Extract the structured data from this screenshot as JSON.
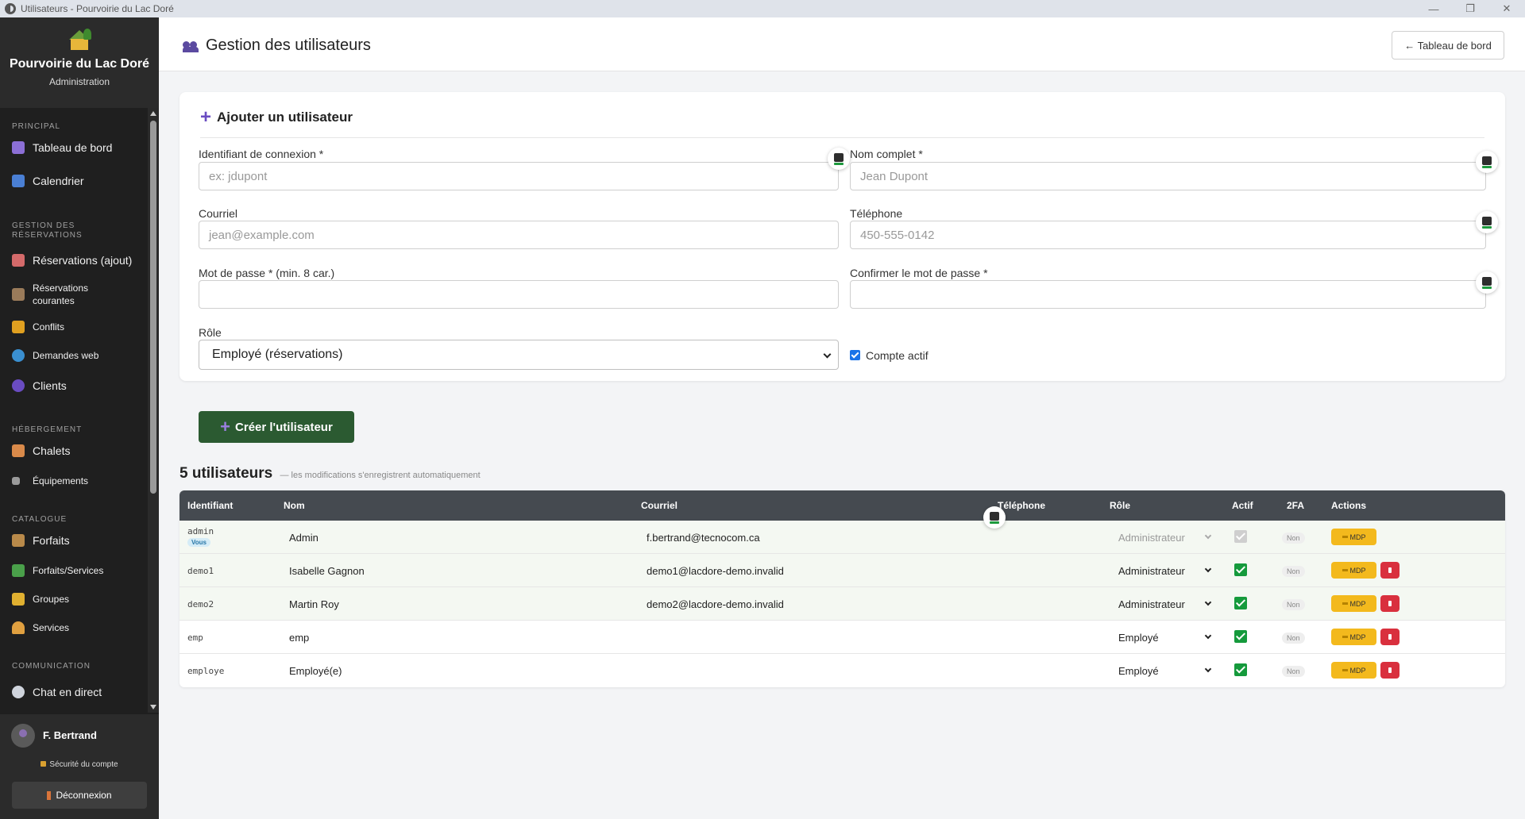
{
  "window": {
    "title": "Utilisateurs - Pourvoirie du Lac Doré",
    "min": "—",
    "restore": "❐",
    "close": "✕"
  },
  "brand": {
    "name": "Pourvoirie du Lac Doré",
    "sub": "Administration",
    "logo_icon": "cabin-logo"
  },
  "sidebar": {
    "sections": [
      {
        "title": "PRINCIPAL",
        "items": [
          {
            "label": "Tableau de bord",
            "icon": "chart-icon",
            "color": "#8c6fd6"
          },
          {
            "label": "Calendrier",
            "icon": "calendar-icon",
            "color": "#4a7fd4"
          }
        ]
      },
      {
        "title": "GESTION DES RÉSERVATIONS",
        "items": [
          {
            "label": "Réservations (ajout)",
            "icon": "memo-icon",
            "color": "#d46a6a"
          },
          {
            "label": "Réservations courantes",
            "icon": "clipboard-icon",
            "color": "#9a7b5a"
          },
          {
            "label": "Conflits",
            "icon": "warning-icon",
            "color": "#e0a020"
          },
          {
            "label": "Demandes web",
            "icon": "globe-icon",
            "color": "#3a8fd0"
          },
          {
            "label": "Clients",
            "icon": "people-icon",
            "color": "#6a4cc1"
          }
        ]
      },
      {
        "title": "HÉBERGEMENT",
        "items": [
          {
            "label": "Chalets",
            "icon": "house-icon",
            "color": "#d98a4a"
          },
          {
            "label": "Équipements",
            "icon": "wrench-icon",
            "color": "#9a9a9a"
          }
        ]
      },
      {
        "title": "CATALOGUE",
        "items": [
          {
            "label": "Forfaits",
            "icon": "package-icon",
            "color": "#b98a4a"
          },
          {
            "label": "Forfaits/Services",
            "icon": "puzzle-icon",
            "color": "#4aa04a"
          },
          {
            "label": "Groupes",
            "icon": "folder-icon",
            "color": "#e0b030"
          },
          {
            "label": "Services",
            "icon": "bell-icon",
            "color": "#e0a040"
          }
        ]
      },
      {
        "title": "COMMUNICATION",
        "items": [
          {
            "label": "Chat en direct",
            "icon": "chat-icon",
            "color": "#cfd4dc"
          }
        ]
      }
    ]
  },
  "user": {
    "name": "F. Bertrand",
    "security": "Sécurité du compte",
    "logout": "Déconnexion"
  },
  "header": {
    "title": "Gestion des utilisateurs",
    "back_label": "← Tableau de bord"
  },
  "form": {
    "title": "Ajouter un utilisateur",
    "login_label": "Identifiant de connexion *",
    "login_placeholder": "ex: jdupont",
    "fullname_label": "Nom complet *",
    "fullname_placeholder": "Jean Dupont",
    "email_label": "Courriel",
    "email_placeholder": "jean@example.com",
    "phone_label": "Téléphone",
    "phone_placeholder": "450-555-0142",
    "password_label": "Mot de passe * (min. 8 car.)",
    "confirm_label": "Confirmer le mot de passe *",
    "role_label": "Rôle",
    "role_value": "Employé (réservations)",
    "active_label": "Compte actif",
    "active_checked": true,
    "create_label": "Créer l'utilisateur"
  },
  "users_table": {
    "count_label": "5 utilisateurs",
    "note": "— les modifications s'enregistrent automatiquement",
    "columns": [
      "Identifiant",
      "Nom",
      "Courriel",
      "Téléphone",
      "Rôle",
      "Actif",
      "2FA",
      "Actions"
    ],
    "you_badge": "Vous",
    "mdp_label": "MDP",
    "rows": [
      {
        "login": "admin",
        "name": "Admin",
        "email": "f.bertrand@tecnocom.ca",
        "phone": "",
        "role": "Administrateur",
        "active": true,
        "twofa": "Non",
        "is_you": true
      },
      {
        "login": "demo1",
        "name": "Isabelle Gagnon",
        "email": "demo1@lacdore-demo.invalid",
        "phone": "",
        "role": "Administrateur",
        "active": true,
        "twofa": "Non",
        "is_you": false
      },
      {
        "login": "demo2",
        "name": "Martin Roy",
        "email": "demo2@lacdore-demo.invalid",
        "phone": "",
        "role": "Administrateur",
        "active": true,
        "twofa": "Non",
        "is_you": false
      },
      {
        "login": "emp",
        "name": "emp",
        "email": "",
        "phone": "",
        "role": "Employé",
        "active": true,
        "twofa": "Non",
        "is_you": false
      },
      {
        "login": "employe",
        "name": "Employé(e)",
        "email": "",
        "phone": "",
        "role": "Employé",
        "active": true,
        "twofa": "Non",
        "is_you": false
      }
    ]
  }
}
